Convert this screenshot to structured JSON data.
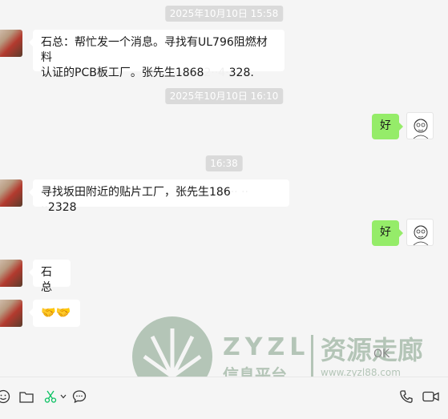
{
  "chat": {
    "timestamps": [
      "2025年10月10日 15:58",
      "2025年10月10日 16:10",
      "16:38"
    ],
    "messages": [
      {
        "text_a": "石总：帮忙发一个消息。寻找有UL796阻燃材料",
        "text_b": "认证的PCB板工厂。张先生1868",
        "redacted": "2··4·",
        "text_c": "328."
      },
      {
        "text": "好"
      },
      {
        "text_a": "寻找坂田附近的贴片工厂，张先生186",
        "redacted": "·· ·· ··",
        "text_c": "2328"
      },
      {
        "text": "好"
      },
      {
        "text": "石总"
      },
      {
        "text": "🤝🤝"
      }
    ]
  },
  "watermark": {
    "brand": "ZYZL",
    "cn_title": "资源走廊",
    "cn_sub": "信息平台",
    "url": "www.zyzl88.com",
    "button": "OK"
  },
  "toolbar": {
    "icons": [
      "emoji-icon",
      "folder-icon",
      "scissors-icon",
      "chat-bubble-icon",
      "phone-icon",
      "video-icon"
    ]
  }
}
